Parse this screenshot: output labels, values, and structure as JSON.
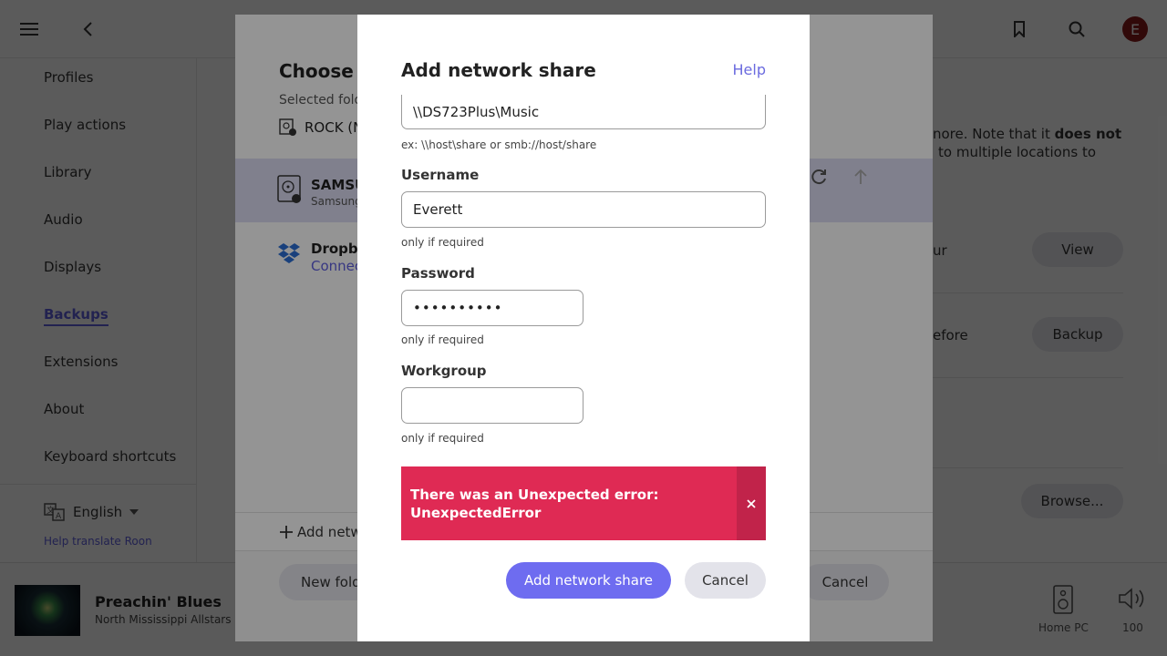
{
  "topbar": {
    "menu_icon": "hamburger-icon",
    "back_icon": "chevron-left-icon",
    "bookmark_icon": "bookmark-icon",
    "search_icon": "search-icon",
    "avatar_letter": "E"
  },
  "sidebar": {
    "items": [
      {
        "label": "Profiles"
      },
      {
        "label": "Play actions"
      },
      {
        "label": "Library"
      },
      {
        "label": "Audio"
      },
      {
        "label": "Displays"
      },
      {
        "label": "Backups"
      },
      {
        "label": "Extensions"
      },
      {
        "label": "About"
      },
      {
        "label": "Keyboard shortcuts"
      }
    ],
    "active_item": "Backups",
    "language": "English",
    "help_translate": "Help translate Roon"
  },
  "settings_bg": {
    "text_line1_prefix": "nore. Note that it ",
    "text_line1_bold": "does not",
    "text_line2": "to multiple locations to",
    "row1_fragment": "ur",
    "row2_fragment": "efore",
    "view_button": "View",
    "backup_button": "Backup",
    "browse_button": "Browse..."
  },
  "choose_folder": {
    "title": "Choose fo",
    "selected_label": "Selected fold",
    "selected_value": "ROCK (N",
    "drives": [
      {
        "name": "SAMSU",
        "sub": "Samsung",
        "selected": true,
        "icon": "hard-drive-icon"
      },
      {
        "name": "Dropbo",
        "sub": "Connec",
        "selected": false,
        "icon": "dropbox-icon"
      }
    ],
    "add_network_link": "Add netw",
    "new_folder_button": "New fold",
    "cancel_button": "Cancel"
  },
  "now_playing": {
    "title": "Preachin' Blues",
    "artist": "North Mississippi Allstars",
    "zone_name": "Home PC",
    "volume": "100"
  },
  "modal": {
    "title": "Add network share",
    "help_link": "Help",
    "share_address": {
      "value": "\\\\DS723Plus\\Music",
      "hint": "ex: \\\\host\\share or smb://host/share"
    },
    "username": {
      "label": "Username",
      "value": "Everett",
      "hint": "only if required"
    },
    "password": {
      "label": "Password",
      "masked_value": "••••••••••",
      "hint": "only if required"
    },
    "workgroup": {
      "label": "Workgroup",
      "value": "",
      "hint": "only if required"
    },
    "error": {
      "line1": "There was an Unexpected error:",
      "line2": "UnexpectedError",
      "color": "#df2a54"
    },
    "add_button": "Add network share",
    "cancel_button": "Cancel"
  },
  "colors": {
    "accent": "#6e6cf0",
    "error": "#df2a54",
    "link": "#6b6bdf"
  }
}
